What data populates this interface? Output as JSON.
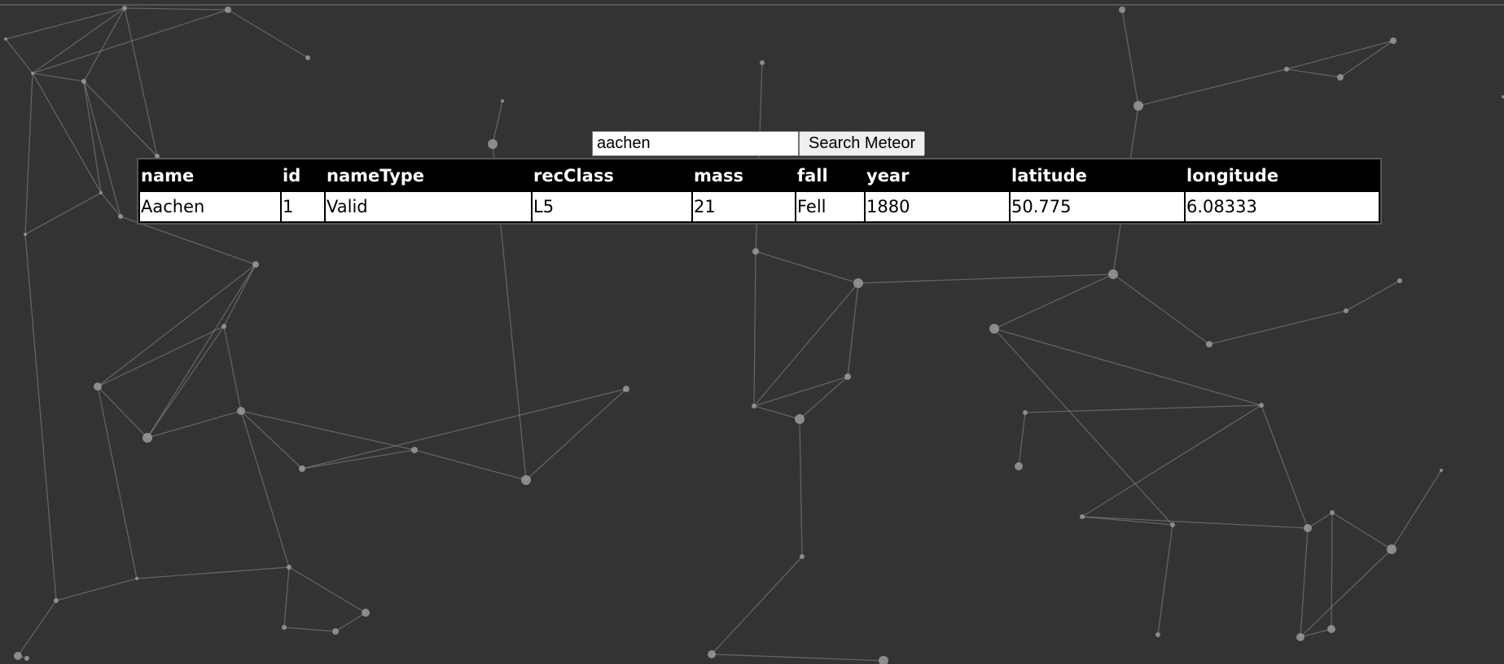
{
  "search": {
    "value": "aachen",
    "button_label": "Search Meteor"
  },
  "table": {
    "headers": [
      "name",
      "id",
      "nameType",
      "recClass",
      "mass",
      "fall",
      "year",
      "latitude",
      "longitude"
    ],
    "rows": [
      [
        "Aachen",
        "1",
        "Valid",
        "L5",
        "21",
        "Fell",
        "1880",
        "50.775",
        "6.08333"
      ]
    ]
  },
  "colors": {
    "background": "#333333",
    "network_line": "#8a8a8a",
    "network_node": "#9a9a9a",
    "table_header_bg": "#000000",
    "table_header_text": "#ffffff",
    "table_cell_bg": "#ffffff"
  }
}
